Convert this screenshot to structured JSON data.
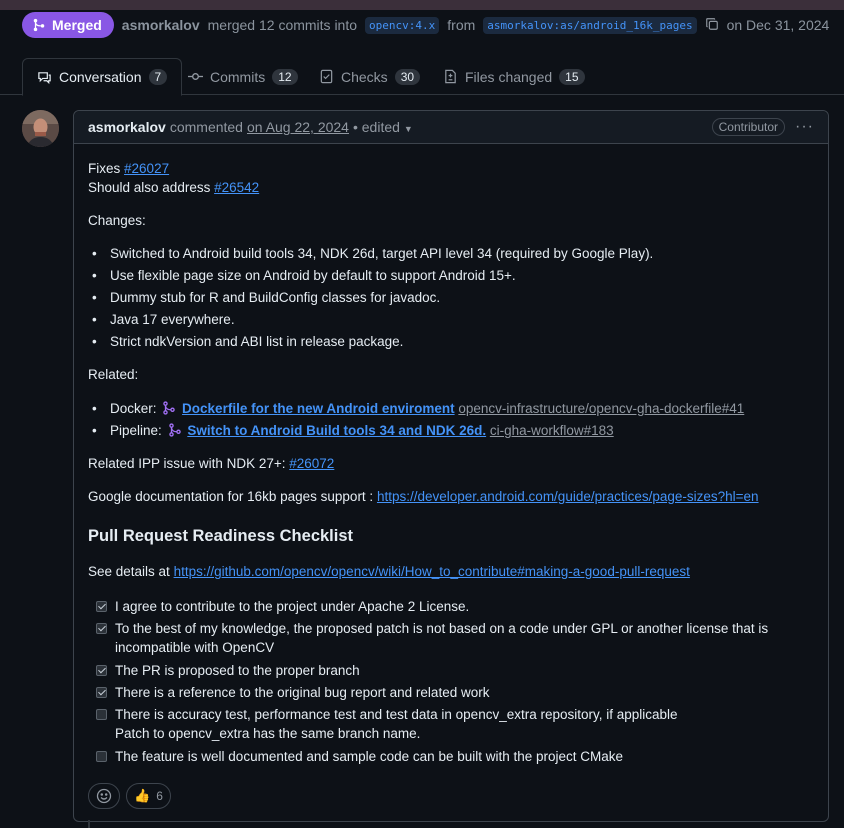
{
  "header": {
    "status": "Merged",
    "user": "asmorkalov",
    "merged_text": "merged 12 commits into",
    "base_branch": "opencv:4.x",
    "from_text": "from",
    "head_branch": "asmorkalov:as/android_16k_pages",
    "date": "on Dec 31, 2024"
  },
  "tabs": [
    {
      "label": "Conversation",
      "count": "7"
    },
    {
      "label": "Commits",
      "count": "12"
    },
    {
      "label": "Checks",
      "count": "30"
    },
    {
      "label": "Files changed",
      "count": "15"
    }
  ],
  "comment": {
    "author": "asmorkalov",
    "commented": "commented",
    "date": "on Aug 22, 2024",
    "edited": "• edited",
    "role": "Contributor",
    "more": "···",
    "fixes_label": "Fixes",
    "fixes_ref": "#26027",
    "address_label": "Should also address",
    "address_ref": "#26542",
    "changes_label": "Changes:",
    "changes": [
      "Switched to Android build tools 34, NDK 26d, target API level 34 (required by Google Play).",
      "Use flexible page size on Android by default to support Android 15+.",
      "Dummy stub for R and BuildConfig classes for javadoc.",
      "Java 17 everywhere.",
      "Strict ndkVersion and ABI list in release package."
    ],
    "related_label": "Related:",
    "related": [
      {
        "prefix": "Docker:",
        "title": "Dockerfile for the new Android enviroment",
        "ref": "opencv-infrastructure/opencv-gha-dockerfile#41"
      },
      {
        "prefix": "Pipeline:",
        "title": "Switch to Android Build tools 34 and NDK 26d.",
        "ref": "ci-gha-workflow#183"
      }
    ],
    "ipp_label": "Related IPP issue with NDK 27+:",
    "ipp_ref": "#26072",
    "docs_label": "Google documentation for 16kb pages support :",
    "docs_url": "https://developer.android.com/guide/practices/page-sizes?hl=en",
    "checklist_title": "Pull Request Readiness Checklist",
    "details_label": "See details at",
    "details_url": "https://github.com/opencv/opencv/wiki/How_to_contribute#making-a-good-pull-request",
    "checklist": [
      {
        "checked": true,
        "text": "I agree to contribute to the project under Apache 2 License."
      },
      {
        "checked": true,
        "text": "To the best of my knowledge, the proposed patch is not based on a code under GPL or another license that is incompatible with OpenCV"
      },
      {
        "checked": true,
        "text": "The PR is proposed to the proper branch"
      },
      {
        "checked": true,
        "text": "There is a reference to the original bug report and related work"
      },
      {
        "checked": false,
        "text": "There is accuracy test, performance test and test data in opencv_extra repository, if applicable"
      },
      {
        "checked": false,
        "text": "The feature is well documented and sample code can be built with the project CMake"
      }
    ],
    "checklist_note": "Patch to opencv_extra has the same branch name.",
    "reaction_emoji": "👍",
    "reaction_count": "6"
  },
  "colors": {
    "merged": "#8957e5",
    "link": "#4493f8",
    "background": "#0d1117"
  }
}
